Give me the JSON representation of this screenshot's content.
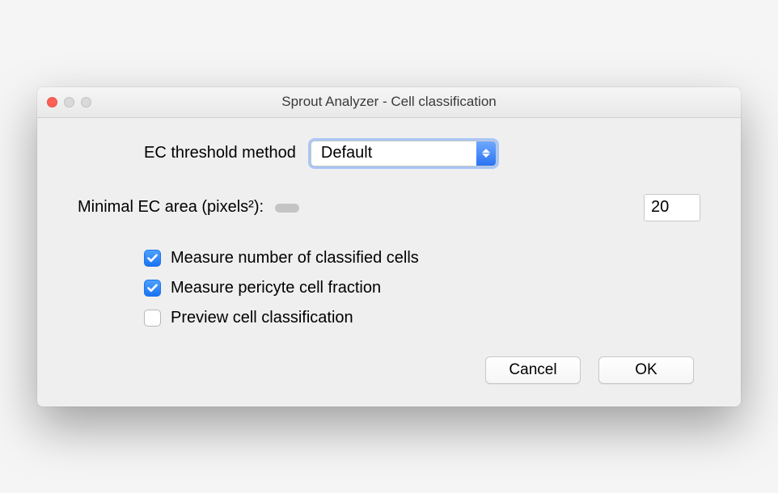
{
  "window": {
    "title": "Sprout Analyzer - Cell classification"
  },
  "fields": {
    "threshold_label": "EC threshold method",
    "threshold_value": "Default",
    "minarea_label": "Minimal EC area (pixels²):",
    "minarea_value": "20"
  },
  "checkboxes": {
    "measure_number": {
      "label": "Measure number of classified cells",
      "checked": true
    },
    "measure_pericyte": {
      "label": "Measure pericyte cell fraction",
      "checked": true
    },
    "preview": {
      "label": "Preview cell classification",
      "checked": false
    }
  },
  "buttons": {
    "cancel": "Cancel",
    "ok": "OK"
  }
}
